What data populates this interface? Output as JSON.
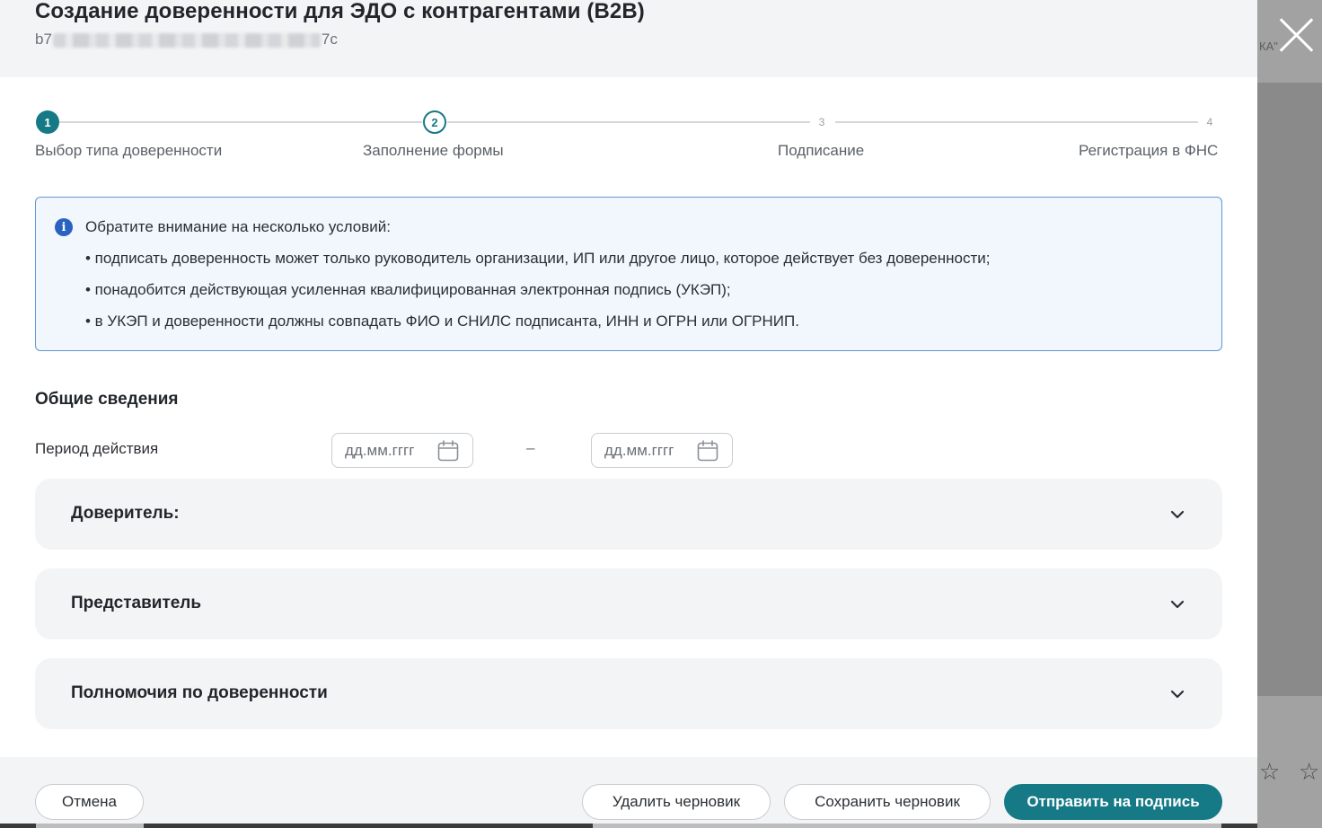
{
  "background": {
    "partial_text": "КА\"",
    "stars": [
      "☆",
      "☆"
    ]
  },
  "modal": {
    "title": "Создание доверенности для ЭДО с контрагентами (B2B)",
    "id_prefix": "b7",
    "id_suffix": "7c"
  },
  "stepper": {
    "steps": [
      {
        "number": "1",
        "label": "Выбор типа доверенности",
        "state": "done"
      },
      {
        "number": "2",
        "label": "Заполнение формы",
        "state": "active"
      },
      {
        "number": "3",
        "label": "Подписание",
        "state": "todo"
      },
      {
        "number": "4",
        "label": "Регистрация в ФНС",
        "state": "todo"
      }
    ]
  },
  "info": {
    "heading": "Обратите внимание на несколько условий:",
    "items": [
      "• подписать доверенность может только руководитель организации, ИП или другое лицо, которое действует без доверенности;",
      "• понадобится действующая усиленная квалифицированная электронная подпись (УКЭП);",
      "• в УКЭП и доверенности должны совпадать ФИО и СНИЛС подписанта, ИНН и ОГРН или ОГРНИП."
    ]
  },
  "general": {
    "title": "Общие сведения",
    "period_label": "Период действия",
    "date_from_placeholder": "дд.мм.гггг",
    "date_to_placeholder": "дд.мм.гггг",
    "separator": "–"
  },
  "accordions": [
    {
      "title": "Доверитель:"
    },
    {
      "title": "Представитель"
    },
    {
      "title": "Полномочия по доверенности"
    }
  ],
  "footer": {
    "cancel": "Отмена",
    "delete_draft": "Удалить черновик",
    "save_draft": "Сохранить черновик",
    "send_to_sign": "Отправить на подпись"
  },
  "colors": {
    "accent": "#157a86",
    "info_border": "#5e97d3",
    "info_bg": "#f1f7fc",
    "info_icon": "#2a63bf"
  }
}
